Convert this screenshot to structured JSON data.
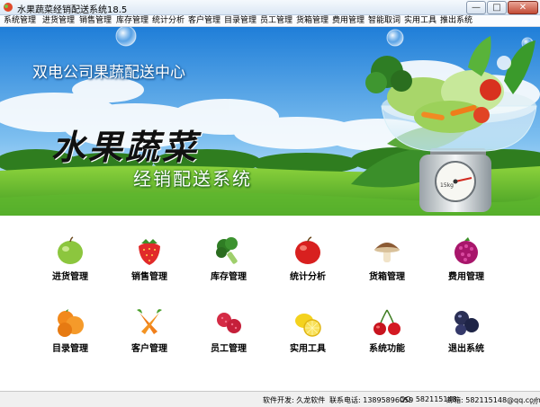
{
  "window": {
    "title": "水果蔬菜经销配送系统18.5",
    "buttons": {
      "minimize": "—",
      "maximize": "□",
      "close": "✕"
    }
  },
  "menu": [
    "系统管理",
    "进货管理",
    "销售管理",
    "库存管理",
    "统计分析",
    "客户管理",
    "目录管理",
    "员工管理",
    "货箱管理",
    "费用管理",
    "智能取词",
    "实用工具",
    "推出系统"
  ],
  "banner": {
    "company": "双电公司果蔬配送中心",
    "title": "水果蔬菜",
    "subtitle": "经销配送系统",
    "scale_label": "15kg"
  },
  "functions": [
    {
      "label": "进货管理",
      "icon": "green-apple-icon"
    },
    {
      "label": "销售管理",
      "icon": "strawberry-icon"
    },
    {
      "label": "库存管理",
      "icon": "broccoli-icon"
    },
    {
      "label": "统计分析",
      "icon": "red-apple-icon"
    },
    {
      "label": "货箱管理",
      "icon": "mushroom-icon"
    },
    {
      "label": "费用管理",
      "icon": "bayberry-icon"
    },
    {
      "label": "目录管理",
      "icon": "oranges-icon"
    },
    {
      "label": "客户管理",
      "icon": "carrots-icon"
    },
    {
      "label": "员工管理",
      "icon": "lychee-icon"
    },
    {
      "label": "实用工具",
      "icon": "lemon-icon"
    },
    {
      "label": "系统功能",
      "icon": "cherries-icon"
    },
    {
      "label": "退出系统",
      "icon": "blueberries-icon"
    }
  ],
  "status": {
    "developer": "软件开发: 久龙软件",
    "phone": "联系电话: 13895896059",
    "qq": "QQ: 582115148",
    "email": "邮箱: 582115148@qq.com"
  },
  "colors": {
    "sky_top": "#1f7ed8",
    "grass": "#4fa92a",
    "title_bar": "#dbe7f4",
    "close_button": "#c24a35"
  }
}
